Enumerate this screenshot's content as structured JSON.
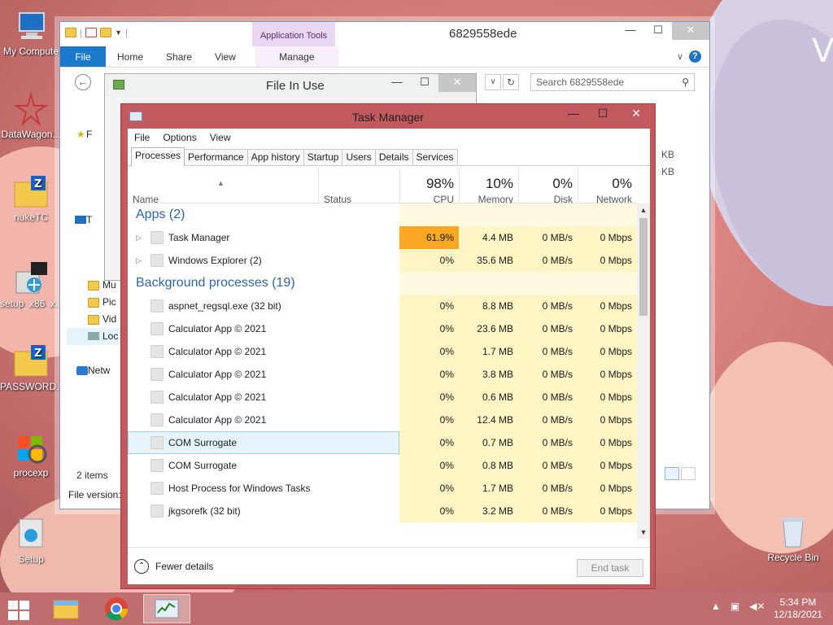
{
  "desktop": {
    "icons": [
      {
        "label": "My Compute"
      },
      {
        "label": "DataWagon..."
      },
      {
        "label": "nukeTC"
      },
      {
        "label": "setup_x86_x..."
      },
      {
        "label": "PASSWORD..."
      },
      {
        "label": "procexp"
      },
      {
        "label": "Setup"
      },
      {
        "label": "Recycle Bin"
      }
    ],
    "corner_text": "V"
  },
  "explorer": {
    "title": "6829558ede",
    "contextual_group": "Application Tools",
    "ribbon_tabs": [
      "File",
      "Home",
      "Share",
      "View",
      "Manage"
    ],
    "search_placeholder": "Search 6829558ede",
    "nav_items": [
      "F",
      "T",
      "Mu",
      "Pic",
      "Vid",
      "Loc",
      "Netw"
    ],
    "status_count": "2 items",
    "file_version_label": "File version:",
    "size_values": [
      "KB",
      "KB"
    ]
  },
  "file_in_use": {
    "title": "File In Use"
  },
  "taskmanager": {
    "title": "Task Manager",
    "menu": [
      "File",
      "Options",
      "View"
    ],
    "tabs": [
      "Processes",
      "Performance",
      "App history",
      "Startup",
      "Users",
      "Details",
      "Services"
    ],
    "active_tab": "Processes",
    "columns": {
      "name": "Name",
      "status": "Status",
      "cpu": {
        "percent": "98%",
        "label": "CPU"
      },
      "memory": {
        "percent": "10%",
        "label": "Memory"
      },
      "disk": {
        "percent": "0%",
        "label": "Disk"
      },
      "network": {
        "percent": "0%",
        "label": "Network"
      }
    },
    "groups": [
      {
        "title": "Apps (2)",
        "processes": [
          {
            "name": "Task Manager",
            "cpu": "61.9%",
            "memory": "4.4 MB",
            "disk": "0 MB/s",
            "network": "0 Mbps",
            "expandable": true,
            "highlight": true
          },
          {
            "name": "Windows Explorer (2)",
            "cpu": "0%",
            "memory": "35.6 MB",
            "disk": "0 MB/s",
            "network": "0 Mbps",
            "expandable": true
          }
        ]
      },
      {
        "title": "Background processes (19)",
        "processes": [
          {
            "name": "aspnet_regsql.exe (32 bit)",
            "cpu": "0%",
            "memory": "8.8 MB",
            "disk": "0 MB/s",
            "network": "0 Mbps"
          },
          {
            "name": "Calculator App © 2021",
            "cpu": "0%",
            "memory": "23.6 MB",
            "disk": "0 MB/s",
            "network": "0 Mbps"
          },
          {
            "name": "Calculator App © 2021",
            "cpu": "0%",
            "memory": "1.7 MB",
            "disk": "0 MB/s",
            "network": "0 Mbps"
          },
          {
            "name": "Calculator App © 2021",
            "cpu": "0%",
            "memory": "3.8 MB",
            "disk": "0 MB/s",
            "network": "0 Mbps"
          },
          {
            "name": "Calculator App © 2021",
            "cpu": "0%",
            "memory": "0.6 MB",
            "disk": "0 MB/s",
            "network": "0 Mbps"
          },
          {
            "name": "Calculator App © 2021",
            "cpu": "0%",
            "memory": "12.4 MB",
            "disk": "0 MB/s",
            "network": "0 Mbps"
          },
          {
            "name": "COM Surrogate",
            "cpu": "0%",
            "memory": "0.7 MB",
            "disk": "0 MB/s",
            "network": "0 Mbps",
            "selected": true
          },
          {
            "name": "COM Surrogate",
            "cpu": "0%",
            "memory": "0.8 MB",
            "disk": "0 MB/s",
            "network": "0 Mbps"
          },
          {
            "name": "Host Process for Windows Tasks",
            "cpu": "0%",
            "memory": "1.7 MB",
            "disk": "0 MB/s",
            "network": "0 Mbps"
          },
          {
            "name": "jkgsorefk (32 bit)",
            "cpu": "0%",
            "memory": "3.2 MB",
            "disk": "0 MB/s",
            "network": "0 Mbps"
          }
        ]
      }
    ],
    "fewer_details": "Fewer details",
    "end_task": "End task"
  },
  "taskbar": {
    "time": "5:34 PM",
    "date": "12/18/2021"
  },
  "colors": {
    "cpu_hot": "#f9a825",
    "heat_light": "#fff4c4",
    "heat_lighter": "#fff9df",
    "group_title": "#3064a8",
    "taskmanager_frame": "#c1595e"
  }
}
